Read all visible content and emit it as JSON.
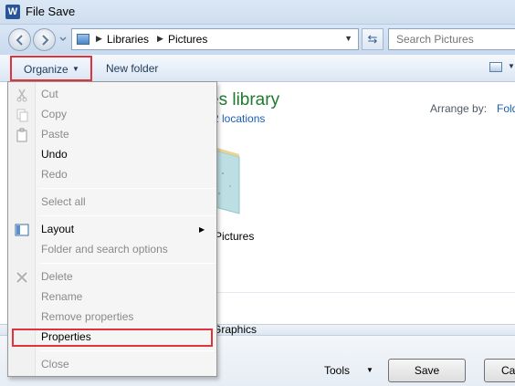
{
  "window": {
    "title": "File Save",
    "app_icon_letter": "W"
  },
  "address_bar": {
    "crumbs": [
      "Libraries",
      "Pictures"
    ]
  },
  "search": {
    "placeholder": "Search Pictures"
  },
  "toolbar": {
    "organize_label": "Organize",
    "new_folder_label": "New folder"
  },
  "content": {
    "library_title": "es library",
    "library_sub": "2 locations",
    "arrange_label": "Arrange by:",
    "arrange_value": "Fold",
    "folder_label": "Pictures"
  },
  "footer": {
    "type_value": "Graphics",
    "tools_label": "Tools",
    "save_label": "Save",
    "cancel_label": "Ca"
  },
  "menu": {
    "cut": "Cut",
    "copy": "Copy",
    "paste": "Paste",
    "undo": "Undo",
    "redo": "Redo",
    "select_all": "Select all",
    "layout": "Layout",
    "folder_options": "Folder and search options",
    "delete": "Delete",
    "rename": "Rename",
    "remove_properties": "Remove properties",
    "properties": "Properties",
    "close": "Close"
  },
  "colors": {
    "highlight_box": "#e0343a",
    "library_title": "#1e7a2e",
    "link": "#1a5fb4"
  }
}
